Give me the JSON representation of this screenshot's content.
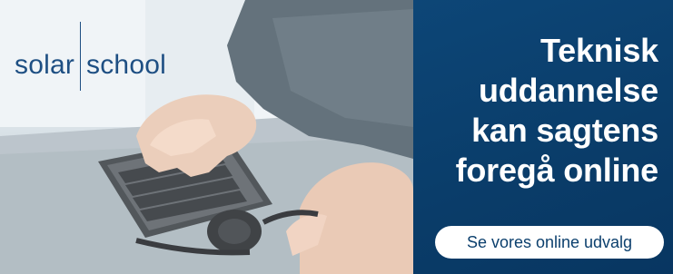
{
  "logo": {
    "part1": "solar",
    "part2": "school"
  },
  "headline": {
    "line1": "Teknisk",
    "line2": "uddannelse",
    "line3": "kan sagtens",
    "line4": "foregå online"
  },
  "cta": {
    "label": "Se vores online udvalg"
  },
  "colors": {
    "panel_blue": "#0b3f6d",
    "logo_blue": "#1e4f83",
    "button_bg": "#ffffff",
    "headline_text": "#ffffff"
  }
}
